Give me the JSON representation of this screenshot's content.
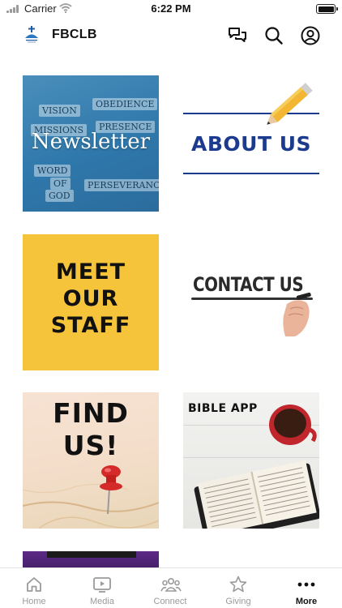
{
  "status_bar": {
    "carrier": "Carrier",
    "time": "6:22 PM"
  },
  "header": {
    "title": "FBCLB",
    "icons": [
      "chat-bubbles-icon",
      "search-icon",
      "account-icon"
    ]
  },
  "tiles": [
    {
      "title": "Newsletter",
      "words": [
        "VISION",
        "OBEDIENCE",
        "MISSIONS",
        "PRESENCE",
        "WORD",
        "OF",
        "GOD",
        "PERSEVERANCE"
      ]
    },
    {
      "title": "ABOUT US"
    },
    {
      "title": "MEET\nOUR\nSTAFF"
    },
    {
      "title": "CONTACT US"
    },
    {
      "title": "FIND\nUS!"
    },
    {
      "title": "BIBLE APP"
    }
  ],
  "tab_bar": {
    "items": [
      {
        "label": "Home",
        "icon": "home-icon"
      },
      {
        "label": "Media",
        "icon": "play-screen-icon"
      },
      {
        "label": "Connect",
        "icon": "people-icon"
      },
      {
        "label": "Giving",
        "icon": "star-icon"
      },
      {
        "label": "More",
        "icon": "more-dots-icon"
      }
    ],
    "active": "More"
  },
  "colors": {
    "newsletter_blue": "#2f78ab",
    "about_navy": "#1d3b8e",
    "staff_yellow": "#f5c43b",
    "promo_purple": "#5b2a86"
  }
}
